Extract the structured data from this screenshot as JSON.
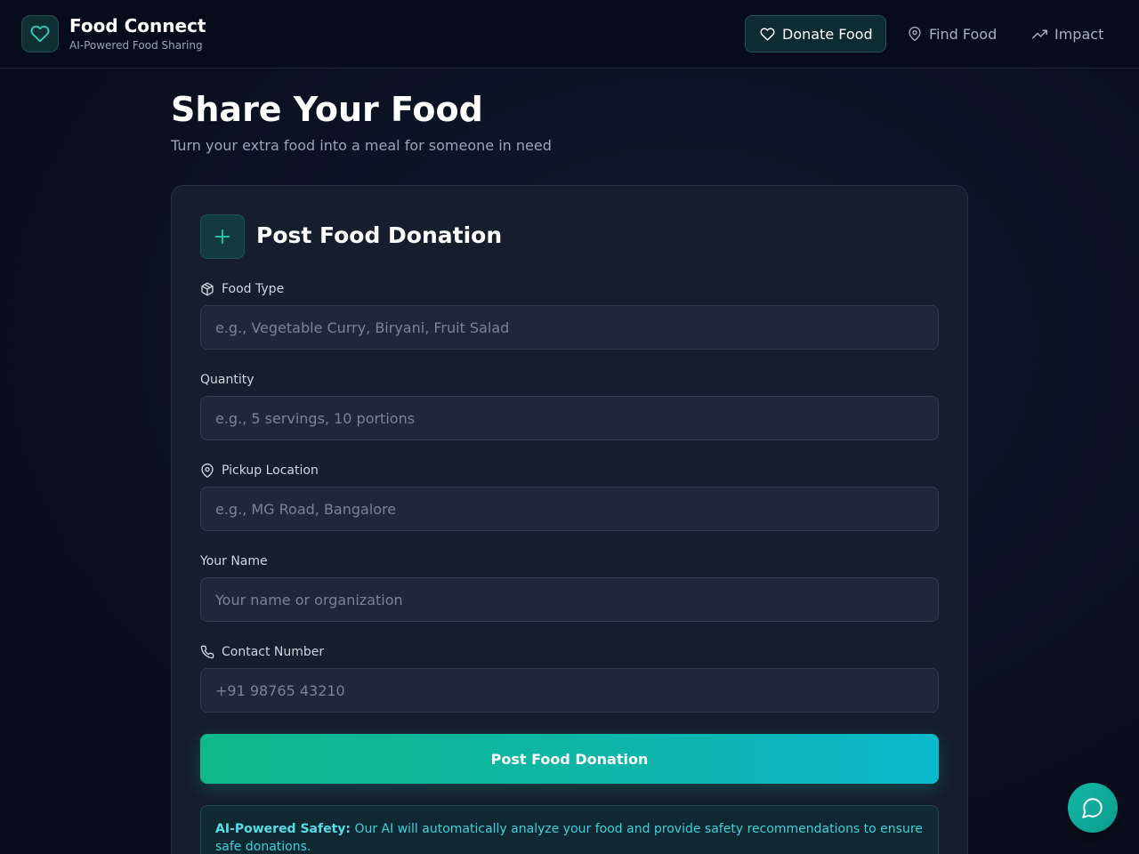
{
  "brand": {
    "name": "Food Connect",
    "tagline": "AI-Powered Food Sharing"
  },
  "nav": {
    "donate": "Donate Food",
    "find": "Find Food",
    "impact": "Impact",
    "active": "Donate Food"
  },
  "page": {
    "title": "Share Your Food",
    "subtitle": "Turn your extra food into a meal for someone in need"
  },
  "form": {
    "title": "Post Food Donation",
    "food_type": {
      "label": "Food Type",
      "placeholder": "e.g., Vegetable Curry, Biryani, Fruit Salad",
      "value": ""
    },
    "quantity": {
      "label": "Quantity",
      "placeholder": "e.g., 5 servings, 10 portions",
      "value": ""
    },
    "location": {
      "label": "Pickup Location",
      "placeholder": "e.g., MG Road, Bangalore",
      "value": ""
    },
    "name": {
      "label": "Your Name",
      "placeholder": "Your name or organization",
      "value": ""
    },
    "contact": {
      "label": "Contact Number",
      "placeholder": "+91 98765 43210",
      "value": ""
    },
    "submit_label": "Post Food Donation"
  },
  "info": {
    "heading": "AI-Powered Safety:",
    "text": " Our AI will automatically analyze your food and provide safety recommendations to ensure safe donations."
  },
  "colors": {
    "accent": "#10b98a",
    "accent_end": "#0cb8cc",
    "background": "#0b1122",
    "card": "#161d2c"
  },
  "icons": {
    "brand": "heart-icon",
    "donate": "heart-icon",
    "find": "map-pin-icon",
    "impact": "trending-up-icon",
    "card": "plus-icon",
    "food_type": "package-icon",
    "location": "map-pin-icon",
    "contact": "phone-icon",
    "chat": "message-circle-icon"
  }
}
